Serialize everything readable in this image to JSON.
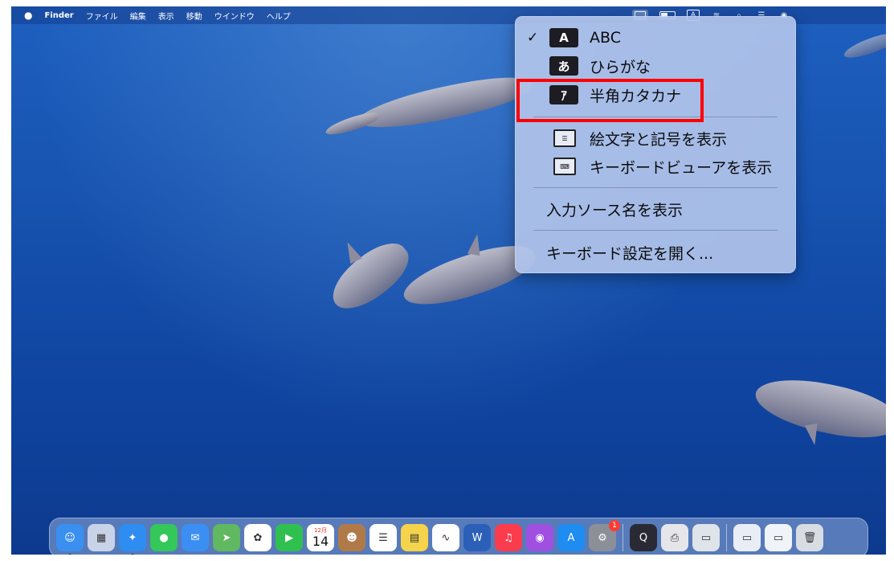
{
  "menubar": {
    "apple": "",
    "app": "Finder",
    "menus": [
      "ファイル",
      "編集",
      "表示",
      "移動",
      "ウインドウ",
      "ヘルプ"
    ],
    "input_indicator": "A"
  },
  "input_menu": {
    "items": [
      {
        "check": "✓",
        "key": "A",
        "label": "ABC"
      },
      {
        "check": "",
        "key": "あ",
        "label": "ひらがな"
      },
      {
        "check": "",
        "key": "ｱ",
        "label": "半角カタカナ"
      }
    ],
    "show_emoji": "絵文字と記号を表示",
    "show_keyboard_viewer": "キーボードビューアを表示",
    "show_input_source_name": "入力ソース名を表示",
    "open_keyboard_settings": "キーボード設定を開く..."
  },
  "dock": {
    "calendar_month": "12月",
    "calendar_day": "14",
    "settings_badge": "1",
    "apps": [
      {
        "name": "finder-icon",
        "color": "#3a8ff0",
        "glyph": "☺"
      },
      {
        "name": "launchpad-icon",
        "color": "#c9d3e8",
        "glyph": "▦"
      },
      {
        "name": "safari-icon",
        "color": "#2f8cf0",
        "glyph": "✦"
      },
      {
        "name": "messages-icon",
        "color": "#34c759",
        "glyph": "●"
      },
      {
        "name": "mail-icon",
        "color": "#3b8ff3",
        "glyph": "✉"
      },
      {
        "name": "maps-icon",
        "color": "#60b860",
        "glyph": "➤"
      },
      {
        "name": "photos-icon",
        "color": "#ffffff",
        "glyph": "✿"
      },
      {
        "name": "facetime-icon",
        "color": "#30c050",
        "glyph": "▶"
      }
    ],
    "apps_after_calendar": [
      {
        "name": "contacts-icon",
        "color": "#b07a48",
        "glyph": "☻"
      },
      {
        "name": "reminders-icon",
        "color": "#ffffff",
        "glyph": "☰"
      },
      {
        "name": "notes-icon",
        "color": "#f5d34a",
        "glyph": "▤"
      },
      {
        "name": "freeform-icon",
        "color": "#ffffff",
        "glyph": "∿"
      },
      {
        "name": "word-icon",
        "color": "#2b5fb8",
        "glyph": "W"
      },
      {
        "name": "music-icon",
        "color": "#fa3c4c",
        "glyph": "♫"
      },
      {
        "name": "podcasts-icon",
        "color": "#a050e0",
        "glyph": "◉"
      },
      {
        "name": "app-store-icon",
        "color": "#1e8cf0",
        "glyph": "A"
      }
    ],
    "group2": [
      {
        "name": "quicktime-icon",
        "color": "#2a2a34",
        "glyph": "Q"
      },
      {
        "name": "printer-icon",
        "color": "#e6e6ea",
        "glyph": "⎙"
      },
      {
        "name": "scanner-icon",
        "color": "#dfe3ea",
        "glyph": "▭"
      }
    ],
    "group3": [
      {
        "name": "folder-doc-icon",
        "color": "#e9eef6",
        "glyph": "▭"
      },
      {
        "name": "folder-doc2-icon",
        "color": "#f0f3f8",
        "glyph": "▭"
      },
      {
        "name": "trash-icon",
        "color": "#d8dde4",
        "glyph": "🗑"
      }
    ]
  }
}
